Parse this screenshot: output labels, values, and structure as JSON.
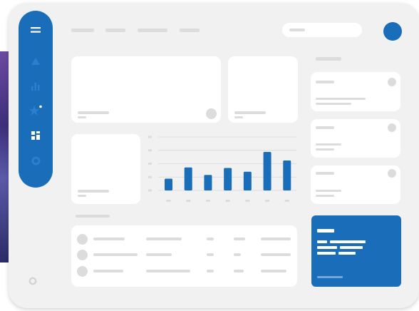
{
  "theme": {
    "accent": "#1a6db8",
    "background": "#f1f1f1",
    "card": "#ffffff",
    "placeholder": "#dcdcdc"
  },
  "sidebar": {
    "items": [
      {
        "icon": "menu-icon"
      },
      {
        "icon": "triangle-icon"
      },
      {
        "icon": "bar-chart-icon"
      },
      {
        "icon": "star-icon",
        "badge": true
      },
      {
        "icon": "dashboard-icon",
        "active": true
      },
      {
        "icon": "ring-icon"
      }
    ],
    "footer_icon": "settings-icon"
  },
  "header": {
    "nav_items": 4,
    "search_icon": "search-field",
    "avatar_icon": "avatar-icon"
  },
  "chart_data": {
    "type": "bar",
    "categories": [
      "",
      "",
      "",
      "",
      "",
      "",
      ""
    ],
    "values": [
      22,
      43,
      29,
      42,
      35,
      72,
      56
    ],
    "ylim": [
      0,
      100
    ],
    "gridlines": 5,
    "color": "#1a6db8"
  },
  "table": {
    "rows": 3
  },
  "right_panel": {
    "cards": 3
  }
}
